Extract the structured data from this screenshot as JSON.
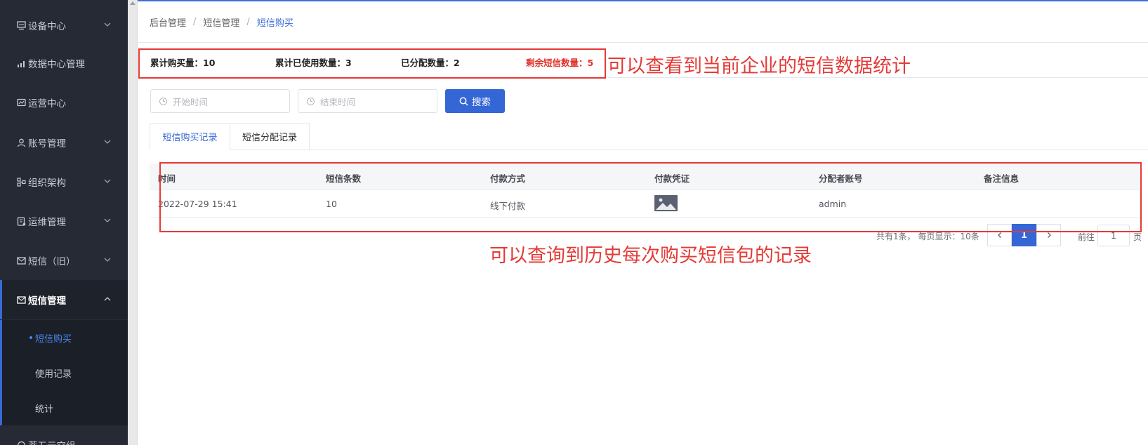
{
  "sidebar": {
    "items": [
      {
        "label": "设备中心",
        "icon": "device-icon",
        "chevron": "down"
      },
      {
        "label": "数据中心管理",
        "icon": "chart-icon",
        "chevron": ""
      },
      {
        "label": "运营中心",
        "icon": "monitor-icon",
        "chevron": ""
      },
      {
        "label": "账号管理",
        "icon": "user-icon",
        "chevron": "down"
      },
      {
        "label": "组织架构",
        "icon": "org-icon",
        "chevron": "down"
      },
      {
        "label": "运维管理",
        "icon": "ops-icon",
        "chevron": "down"
      },
      {
        "label": "短信（旧）",
        "icon": "mail-icon",
        "chevron": "down"
      },
      {
        "label": "短信管理",
        "icon": "mail-icon",
        "chevron": "up"
      }
    ],
    "sub_items": [
      {
        "label": "短信购买"
      },
      {
        "label": "使用记录"
      },
      {
        "label": "统计"
      }
    ],
    "bottom_label": "蒂五元空组"
  },
  "breadcrumb": [
    "后台管理",
    "短信管理",
    "短信购买"
  ],
  "stats": {
    "total_purchased": "累计购买量：10",
    "total_used": "累计已使用数量：3",
    "allocated": "已分配数量：2",
    "remaining": "剩余短信数量：5"
  },
  "filters": {
    "start_placeholder": "开始时间",
    "end_placeholder": "结束时间",
    "search_label": "搜索"
  },
  "tabs": [
    "短信购买记录",
    "短信分配记录"
  ],
  "table": {
    "columns": [
      "时间",
      "短信条数",
      "付款方式",
      "付款凭证",
      "分配者账号",
      "备注信息"
    ],
    "rows": [
      {
        "time": "2022-07-29 15:41",
        "count": "10",
        "payment": "线下付款",
        "voucher": "image-thumbnail",
        "assigner": "admin",
        "note": ""
      }
    ]
  },
  "pagination": {
    "total_text": "共有1条， 每页显示：10条",
    "current": "1",
    "goto_label": "前往",
    "goto_value": "1",
    "goto_suffix": "页"
  },
  "annotations": {
    "stats_note": "可以查看到当前企业的短信数据统计",
    "table_note": "可以查询到历史每次购买短信包的记录"
  },
  "colors": {
    "accent": "#3566d6",
    "annotation": "#e53a36",
    "sidebar": "#252a34"
  }
}
